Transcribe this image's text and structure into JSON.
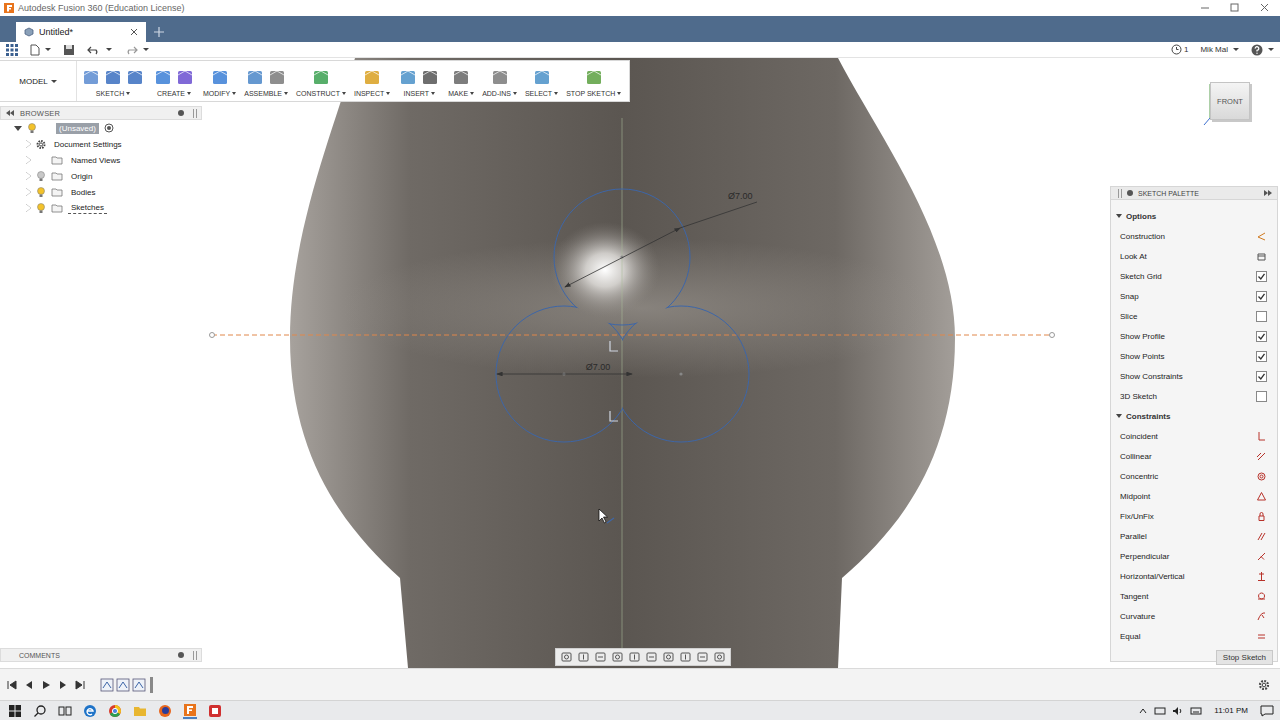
{
  "window": {
    "title": "Autodesk Fusion 360 (Education License)"
  },
  "tabs": [
    {
      "label": "Untitled*",
      "selected": true
    }
  ],
  "quick_access": {
    "jobs": "1",
    "user": "Mik Mal"
  },
  "workspace": "MODEL",
  "toolbar": [
    {
      "label": "SKETCH"
    },
    {
      "label": "CREATE"
    },
    {
      "label": "MODIFY"
    },
    {
      "label": "ASSEMBLE"
    },
    {
      "label": "CONSTRUCT"
    },
    {
      "label": "INSPECT"
    },
    {
      "label": "INSERT"
    },
    {
      "label": "MAKE"
    },
    {
      "label": "ADD-INS"
    },
    {
      "label": "SELECT"
    },
    {
      "label": "STOP SKETCH"
    }
  ],
  "browser": {
    "title": "BROWSER",
    "items": [
      {
        "label": "(Unsaved)",
        "depth": 0,
        "kind": "root",
        "expanded": true,
        "selected": true,
        "visible": true,
        "active": false
      },
      {
        "label": "Document Settings",
        "depth": 1,
        "kind": "settings",
        "expanded": false,
        "selected": false,
        "active": false
      },
      {
        "label": "Named Views",
        "depth": 1,
        "kind": "views",
        "expanded": false,
        "selected": false,
        "active": false
      },
      {
        "label": "Origin",
        "depth": 1,
        "kind": "folder",
        "expanded": false,
        "selected": false,
        "visible": false,
        "active": false
      },
      {
        "label": "Bodies",
        "depth": 1,
        "kind": "folder",
        "expanded": false,
        "selected": false,
        "visible": true,
        "active": false
      },
      {
        "label": "Sketches",
        "depth": 1,
        "kind": "folder",
        "expanded": false,
        "selected": false,
        "visible": true,
        "active": true
      }
    ]
  },
  "view_cube": {
    "face": "FRONT"
  },
  "sketch": {
    "dimensions": [
      {
        "text": "Ø7.00"
      },
      {
        "text": "Ø7.00"
      }
    ]
  },
  "sketch_palette": {
    "title": "SKETCH PALETTE",
    "sections": [
      {
        "title": "Options",
        "expanded": true,
        "rows": [
          {
            "label": "Construction",
            "kind": "button"
          },
          {
            "label": "Look At",
            "kind": "button"
          },
          {
            "label": "Sketch Grid",
            "kind": "checkbox",
            "checked": true
          },
          {
            "label": "Snap",
            "kind": "checkbox",
            "checked": true
          },
          {
            "label": "Slice",
            "kind": "checkbox",
            "checked": false
          },
          {
            "label": "Show Profile",
            "kind": "checkbox",
            "checked": true
          },
          {
            "label": "Show Points",
            "kind": "checkbox",
            "checked": true
          },
          {
            "label": "Show Constraints",
            "kind": "checkbox",
            "checked": true
          },
          {
            "label": "3D Sketch",
            "kind": "checkbox",
            "checked": false
          }
        ]
      },
      {
        "title": "Constraints",
        "expanded": true,
        "rows": [
          {
            "label": "Coincident",
            "kind": "button"
          },
          {
            "label": "Collinear",
            "kind": "button"
          },
          {
            "label": "Concentric",
            "kind": "button"
          },
          {
            "label": "Midpoint",
            "kind": "button"
          },
          {
            "label": "Fix/UnFix",
            "kind": "button"
          },
          {
            "label": "Parallel",
            "kind": "button"
          },
          {
            "label": "Perpendicular",
            "kind": "button"
          },
          {
            "label": "Horizontal/Vertical",
            "kind": "button"
          },
          {
            "label": "Tangent",
            "kind": "button"
          },
          {
            "label": "Curvature",
            "kind": "button"
          },
          {
            "label": "Equal",
            "kind": "button"
          }
        ]
      }
    ],
    "button": "Stop Sketch"
  },
  "comments": {
    "title": "COMMENTS"
  },
  "taskbar": {
    "time": "11:01 PM"
  }
}
